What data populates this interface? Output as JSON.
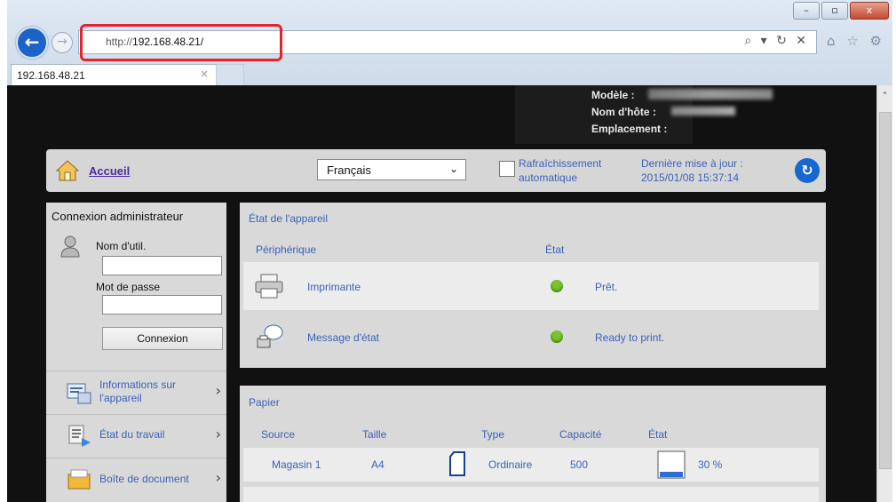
{
  "browser": {
    "url_prefix": "http://",
    "url_host": "192.168.48.21/",
    "address_controls": "⌕ ▾ ↻ ✕",
    "tab_title": "192.168.48.21",
    "tab_close": "×",
    "toolbar_icons": "⌂ ☆ ⚙",
    "window_buttons": [
      "–",
      "▫",
      "x"
    ],
    "highlight_color": "#e3252b"
  },
  "device": {
    "model_label": "Modèle :",
    "host_label": "Nom d'hôte :",
    "location_label": "Emplacement :"
  },
  "topbar": {
    "home_label": "Accueil",
    "language": "Français",
    "auto_refresh": [
      "Rafraîchissement",
      "automatique"
    ],
    "last_update": [
      "Dernière mise à jour :",
      "2015/01/08 15:37:14"
    ]
  },
  "login": {
    "title": "Connexion administrateur",
    "username_label": "Nom d'util.",
    "username_value": "",
    "password_label": "Mot de passe",
    "password_value": "",
    "button_label": "Connexion"
  },
  "nav": [
    {
      "label_lines": [
        "Informations sur",
        "l'appareil"
      ],
      "icon": "device-info-icon"
    },
    {
      "label_lines": [
        "État du travail"
      ],
      "icon": "job-status-icon"
    },
    {
      "label_lines": [
        "Boîte de document"
      ],
      "icon": "document-box-icon"
    }
  ],
  "device_status": {
    "title": "État de l'appareil",
    "col_device": "Périphérique",
    "col_state": "État",
    "rows": [
      {
        "name": "Imprimante",
        "state": "Prêt.",
        "icon": "printer-icon",
        "status_color": "#7cc230"
      },
      {
        "name": "Message d'état",
        "state": "Ready to print.",
        "icon": "message-icon",
        "status_color": "#7cc230"
      }
    ]
  },
  "paper": {
    "title": "Papier",
    "columns": [
      "Source",
      "Taille",
      "Type",
      "Capacité",
      "État"
    ],
    "rows": [
      {
        "source": "Magasin 1",
        "size": "A4",
        "type": "Ordinaire",
        "capacity": "500",
        "level": "30 %",
        "level_fraction": 0.3
      }
    ]
  },
  "colors": {
    "link": "#3a62b8",
    "home_link": "#4a2aa0",
    "page_background": "#111111",
    "panel": "#d9d9d9"
  }
}
